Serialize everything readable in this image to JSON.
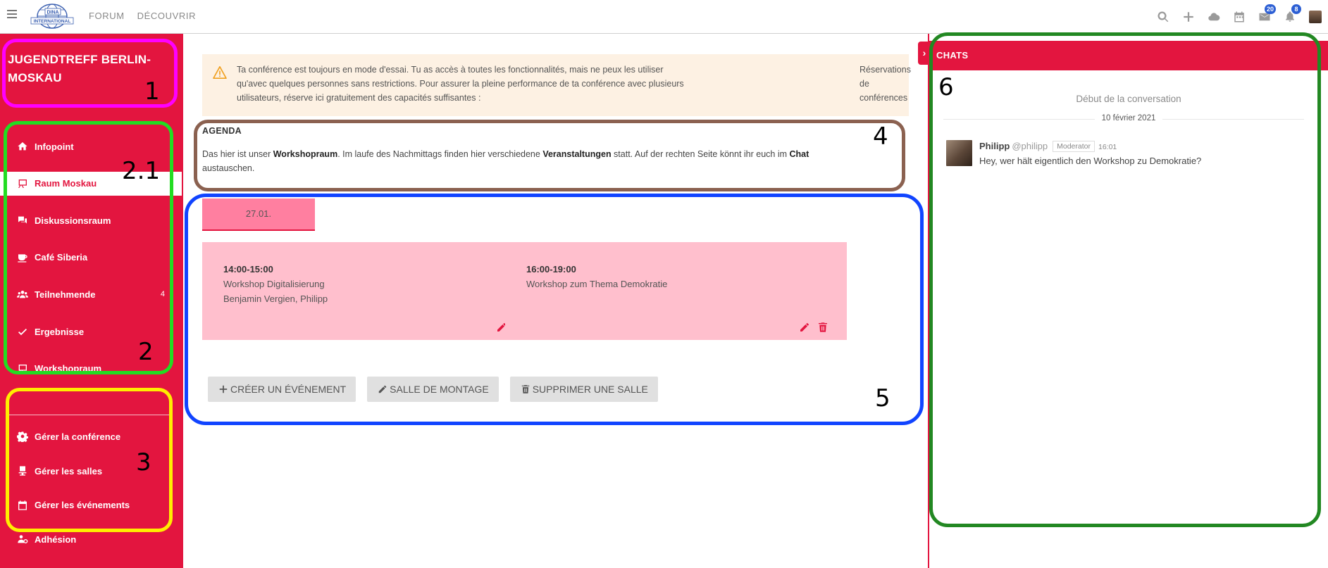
{
  "topbar": {
    "logo_text": "DINA INTERNATIONAL",
    "nav": [
      "FORUM",
      "DÉCOUVRIR"
    ],
    "icons": [
      "search-icon",
      "plus-icon",
      "cloud-icon",
      "calendar-icon",
      "mail-icon",
      "bell-icon",
      "user-avatar"
    ],
    "mail_badge": "20",
    "bell_badge": "8"
  },
  "sidebar": {
    "conference_title": "JUGENDTREFF BERLIN-MOSKAU",
    "rooms": [
      {
        "label": "Infopoint",
        "icon": "home-icon"
      },
      {
        "label": "Raum Moskau",
        "icon": "chalkboard-icon",
        "active": true
      },
      {
        "label": "Diskussionsraum",
        "icon": "comments-icon"
      },
      {
        "label": "Café Siberia",
        "icon": "coffee-icon"
      },
      {
        "label": "Teilnehmende",
        "icon": "users-icon",
        "count": "4"
      },
      {
        "label": "Ergebnisse",
        "icon": "check-icon"
      },
      {
        "label": "Workshopraum",
        "icon": "chalkboard-icon"
      }
    ],
    "admin": [
      {
        "label": "Gérer la conférence",
        "icon": "gear-icon"
      },
      {
        "label": "Gérer les salles",
        "icon": "lectern-icon"
      },
      {
        "label": "Gérer les événements",
        "icon": "calendar-icon"
      },
      {
        "label": "Adhésion",
        "icon": "users-gear-icon"
      }
    ]
  },
  "notice": {
    "text": "Ta conférence est toujours en mode d'essai. Tu as accès à toutes les fonctionnalités, mais ne peux les utiliser qu'avec quelques personnes sans restrictions. Pour assurer la pleine performance de ta conférence avec plusieurs utilisateurs, réserve ici gratuitement des capacités suffisantes :",
    "link": "Réservations de conférences"
  },
  "agenda": {
    "title": "AGENDA",
    "p1": "Das hier ist unser ",
    "b1": "Workshopraum",
    "p2": ". Im laufe des Nachmittags finden hier verschiedene ",
    "b2": "Veranstaltungen",
    "p3": " statt. Auf der rechten Seite könnt ihr euch im ",
    "b3": "Chat",
    "p4": " austauschen."
  },
  "date_tab": "27.01.",
  "events": [
    {
      "time": "14:00-15:00",
      "title": "Workshop Digitalisierung",
      "people": "Benjamin Vergien, Philipp"
    },
    {
      "time": "16:00-19:00",
      "title": "Workshop zum Thema Demokratie",
      "people": ""
    }
  ],
  "actions": {
    "create": "CRÉER UN ÉVÉNEMENT",
    "edit": "SALLE DE MONTAGE",
    "delete": "SUPPRIMER UNE SALLE"
  },
  "chat": {
    "title": "CHATS",
    "toggle": "›",
    "start": "Début de la conversation",
    "date": "10 février 2021",
    "messages": [
      {
        "name": "Philipp",
        "handle": "@philipp",
        "role": "Moderator",
        "time": "16:01",
        "text": "Hey, wer hält eigentlich den Workshop zu Demokratie?"
      }
    ]
  },
  "annotations": {
    "colors": {
      "1": "#ff00ff",
      "2": "#22dd22",
      "3": "#ffee00",
      "4": "#8b6150",
      "5": "#1144ff",
      "6": "#228822"
    },
    "labels": [
      "1",
      "2",
      "2.1",
      "3",
      "4",
      "5",
      "6"
    ]
  }
}
